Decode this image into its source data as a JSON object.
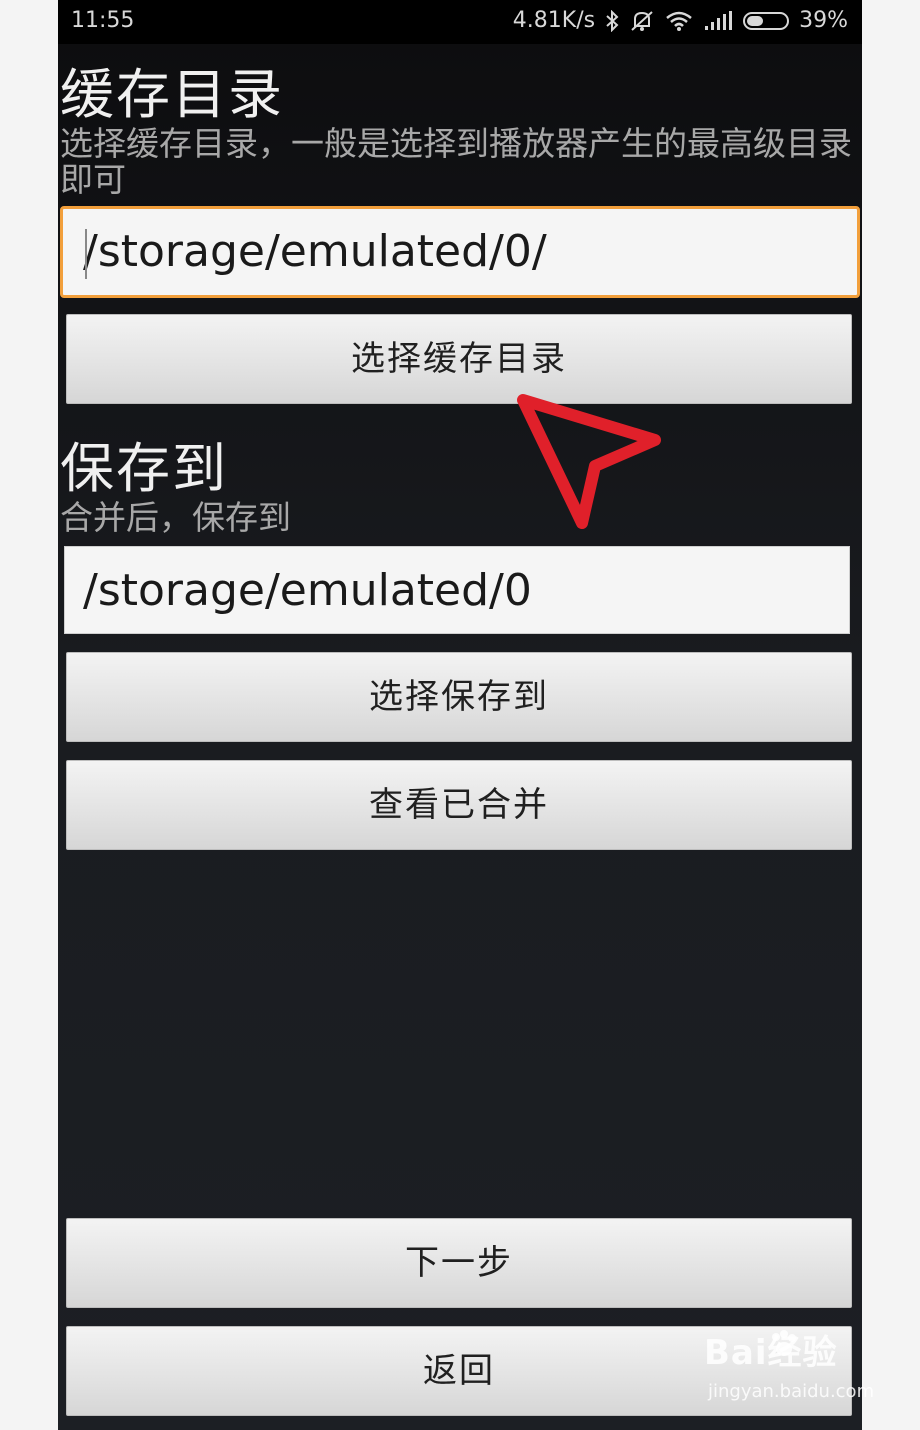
{
  "status_bar": {
    "time": "11:55",
    "speed": "4.81K/s",
    "battery": "39%",
    "icons": [
      "bluetooth-icon",
      "mute-icon",
      "wifi-icon",
      "signal-icon",
      "battery-icon"
    ]
  },
  "cache_section": {
    "title": "缓存目录",
    "description": "选择缓存目录，一般是选择到播放器产生的最高级目录即可",
    "path_value": "/storage/emulated/0/",
    "button_label": "选择缓存目录"
  },
  "save_section": {
    "title": "保存到",
    "description": "合并后，保存到",
    "path_value": "/storage/emulated/0",
    "button_label": "选择保存到",
    "view_merged_label": "查看已合并"
  },
  "footer": {
    "next_label": "下一步",
    "back_label": "返回"
  },
  "watermark": {
    "brand": "Bai经验",
    "site": "jingyan.baidu.com"
  },
  "colors": {
    "focus_border": "#f29f3b",
    "annotation_arrow": "#e0202a"
  }
}
